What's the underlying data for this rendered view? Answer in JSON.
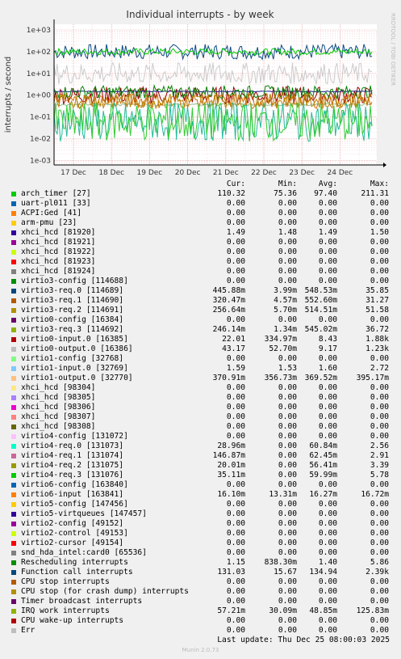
{
  "chart_data": {
    "type": "line",
    "title": "Individual interrupts - by week",
    "ylabel": "interrupts / second",
    "yscale": "log",
    "ylim": [
      0.0005,
      2000
    ],
    "yticks": [
      "1e+03",
      "1e+02",
      "1e+01",
      "1e+00",
      "1e-01",
      "1e-02",
      "1e-03"
    ],
    "xticks": [
      "17 Dec",
      "18 Dec",
      "19 Dec",
      "20 Dec",
      "21 Dec",
      "22 Dec",
      "23 Dec",
      "24 Dec"
    ],
    "grid": true,
    "series": [
      {
        "name": "Function call interrupts",
        "color": "#0c4a83",
        "level": 100,
        "spread": 0.35
      },
      {
        "name": "arch_timer [27]",
        "color": "#00cc00",
        "level": 100,
        "spread": 0.15
      },
      {
        "name": "virtio1-output.0 [32770]",
        "color": "#8fbc8f",
        "level": 0.37,
        "spread": 0.05
      },
      {
        "name": "virtio0-input.0 [16385]",
        "color": "#990000",
        "level": 1.0,
        "spread": 0.4
      },
      {
        "name": "xhci_hcd [81920]",
        "color": "#1c1c8c",
        "level": 1.49,
        "spread": 0.02
      },
      {
        "name": "Rescheduling interrupts",
        "color": "#008000",
        "level": 1.4,
        "spread": 0.3
      },
      {
        "name": "virtio0-output.0 [16386]",
        "color": "#cccccc",
        "level": 10,
        "spread": 0.5
      },
      {
        "name": "virtio3-req.1 [114690]",
        "color": "#cc7000",
        "level": 0.55,
        "spread": 0.35
      },
      {
        "name": "virtio3-req.3 [114692]",
        "color": "#b8860b",
        "level": 0.55,
        "spread": 0.35
      },
      {
        "name": "virtio4-req.0 [131073]",
        "color": "#22bb99",
        "level": 0.06,
        "spread": 0.9
      },
      {
        "name": "virtio4-req.3 [131076]",
        "color": "#33cc33",
        "level": 0.06,
        "spread": 0.9
      }
    ],
    "legend_header": {
      "cur": "Cur:",
      "min": "Min:",
      "avg": "Avg:",
      "max": "Max:"
    },
    "legend": [
      {
        "name": "arch_timer [27]",
        "color": "#00cc00",
        "cur": "110.32",
        "min": "75.36",
        "avg": "97.40",
        "max": "211.31"
      },
      {
        "name": "uart-pl011 [33]",
        "color": "#0066b3",
        "cur": "0.00",
        "min": "0.00",
        "avg": "0.00",
        "max": "0.00"
      },
      {
        "name": "ACPI:Ged [41]",
        "color": "#ff8000",
        "cur": "0.00",
        "min": "0.00",
        "avg": "0.00",
        "max": "0.00"
      },
      {
        "name": "arm-pmu [23]",
        "color": "#ffcc00",
        "cur": "0.00",
        "min": "0.00",
        "avg": "0.00",
        "max": "0.00"
      },
      {
        "name": "xhci_hcd [81920]",
        "color": "#330099",
        "cur": "1.49",
        "min": "1.48",
        "avg": "1.49",
        "max": "1.50"
      },
      {
        "name": "xhci_hcd [81921]",
        "color": "#990099",
        "cur": "0.00",
        "min": "0.00",
        "avg": "0.00",
        "max": "0.00"
      },
      {
        "name": "xhci_hcd [81922]",
        "color": "#ccff00",
        "cur": "0.00",
        "min": "0.00",
        "avg": "0.00",
        "max": "0.00"
      },
      {
        "name": "xhci_hcd [81923]",
        "color": "#ff0000",
        "cur": "0.00",
        "min": "0.00",
        "avg": "0.00",
        "max": "0.00"
      },
      {
        "name": "xhci_hcd [81924]",
        "color": "#808080",
        "cur": "0.00",
        "min": "0.00",
        "avg": "0.00",
        "max": "0.00"
      },
      {
        "name": "virtio3-config [114688]",
        "color": "#008f00",
        "cur": "0.00",
        "min": "0.00",
        "avg": "0.00",
        "max": "0.00"
      },
      {
        "name": "virtio3-req.0 [114689]",
        "color": "#00487d",
        "cur": "445.88m",
        "min": "3.99m",
        "avg": "548.53m",
        "max": "35.85"
      },
      {
        "name": "virtio3-req.1 [114690]",
        "color": "#b35a00",
        "cur": "320.47m",
        "min": "4.57m",
        "avg": "552.60m",
        "max": "31.27"
      },
      {
        "name": "virtio3-req.2 [114691]",
        "color": "#b38f00",
        "cur": "256.64m",
        "min": "5.70m",
        "avg": "514.51m",
        "max": "51.58"
      },
      {
        "name": "virtio0-config [16384]",
        "color": "#6b006b",
        "cur": "0.00",
        "min": "0.00",
        "avg": "0.00",
        "max": "0.00"
      },
      {
        "name": "virtio3-req.3 [114692]",
        "color": "#8fb300",
        "cur": "246.14m",
        "min": "1.34m",
        "avg": "545.02m",
        "max": "36.72"
      },
      {
        "name": "virtio0-input.0 [16385]",
        "color": "#b30000",
        "cur": "22.01",
        "min": "334.97m",
        "avg": "8.43",
        "max": "1.88k"
      },
      {
        "name": "virtio0-output.0 [16386]",
        "color": "#bebebe",
        "cur": "43.17",
        "min": "52.70m",
        "avg": "9.17",
        "max": "1.23k"
      },
      {
        "name": "virtio1-config [32768]",
        "color": "#80ff80",
        "cur": "0.00",
        "min": "0.00",
        "avg": "0.00",
        "max": "0.00"
      },
      {
        "name": "virtio1-input.0 [32769]",
        "color": "#80c9ff",
        "cur": "1.59",
        "min": "1.53",
        "avg": "1.60",
        "max": "2.72"
      },
      {
        "name": "virtio1-output.0 [32770]",
        "color": "#ffc080",
        "cur": "370.91m",
        "min": "356.73m",
        "avg": "369.52m",
        "max": "395.17m"
      },
      {
        "name": "xhci_hcd [98304]",
        "color": "#ffe680",
        "cur": "0.00",
        "min": "0.00",
        "avg": "0.00",
        "max": "0.00"
      },
      {
        "name": "xhci_hcd [98305]",
        "color": "#aa80ff",
        "cur": "0.00",
        "min": "0.00",
        "avg": "0.00",
        "max": "0.00"
      },
      {
        "name": "xhci_hcd [98306]",
        "color": "#ee00cc",
        "cur": "0.00",
        "min": "0.00",
        "avg": "0.00",
        "max": "0.00"
      },
      {
        "name": "xhci_hcd [98307]",
        "color": "#ff8080",
        "cur": "0.00",
        "min": "0.00",
        "avg": "0.00",
        "max": "0.00"
      },
      {
        "name": "xhci_hcd [98308]",
        "color": "#666600",
        "cur": "0.00",
        "min": "0.00",
        "avg": "0.00",
        "max": "0.00"
      },
      {
        "name": "virtio4-config [131072]",
        "color": "#ffbfff",
        "cur": "0.00",
        "min": "0.00",
        "avg": "0.00",
        "max": "0.00"
      },
      {
        "name": "virtio4-req.0 [131073]",
        "color": "#00ffcc",
        "cur": "28.96m",
        "min": "0.00",
        "avg": "60.84m",
        "max": "2.56"
      },
      {
        "name": "virtio4-req.1 [131074]",
        "color": "#cc6699",
        "cur": "146.87m",
        "min": "0.00",
        "avg": "62.45m",
        "max": "2.91"
      },
      {
        "name": "virtio4-req.2 [131075]",
        "color": "#999900",
        "cur": "20.01m",
        "min": "0.00",
        "avg": "56.41m",
        "max": "3.39"
      },
      {
        "name": "virtio4-req.3 [131076]",
        "color": "#00cc00",
        "cur": "35.11m",
        "min": "0.00",
        "avg": "59.99m",
        "max": "5.78"
      },
      {
        "name": "virtio6-config [163840]",
        "color": "#0066b3",
        "cur": "0.00",
        "min": "0.00",
        "avg": "0.00",
        "max": "0.00"
      },
      {
        "name": "virtio6-input [163841]",
        "color": "#ff8000",
        "cur": "16.10m",
        "min": "13.31m",
        "avg": "16.27m",
        "max": "16.72m"
      },
      {
        "name": "virtio5-config [147456]",
        "color": "#ffcc00",
        "cur": "0.00",
        "min": "0.00",
        "avg": "0.00",
        "max": "0.00"
      },
      {
        "name": "virtio5-virtqueues [147457]",
        "color": "#330099",
        "cur": "0.00",
        "min": "0.00",
        "avg": "0.00",
        "max": "0.00"
      },
      {
        "name": "virtio2-config [49152]",
        "color": "#990099",
        "cur": "0.00",
        "min": "0.00",
        "avg": "0.00",
        "max": "0.00"
      },
      {
        "name": "virtio2-control [49153]",
        "color": "#ccff00",
        "cur": "0.00",
        "min": "0.00",
        "avg": "0.00",
        "max": "0.00"
      },
      {
        "name": "virtio2-cursor [49154]",
        "color": "#ff0000",
        "cur": "0.00",
        "min": "0.00",
        "avg": "0.00",
        "max": "0.00"
      },
      {
        "name": "snd_hda_intel:card0 [65536]",
        "color": "#808080",
        "cur": "0.00",
        "min": "0.00",
        "avg": "0.00",
        "max": "0.00"
      },
      {
        "name": "Rescheduling interrupts",
        "color": "#008f00",
        "cur": "1.15",
        "min": "838.30m",
        "avg": "1.40",
        "max": "5.86"
      },
      {
        "name": "Function call interrupts",
        "color": "#00487d",
        "cur": "131.03",
        "min": "15.67",
        "avg": "134.94",
        "max": "2.39k"
      },
      {
        "name": "CPU stop interrupts",
        "color": "#b35a00",
        "cur": "0.00",
        "min": "0.00",
        "avg": "0.00",
        "max": "0.00"
      },
      {
        "name": "CPU stop (for crash dump) interrupts",
        "color": "#b38f00",
        "cur": "0.00",
        "min": "0.00",
        "avg": "0.00",
        "max": "0.00"
      },
      {
        "name": "Timer broadcast interrupts",
        "color": "#6b006b",
        "cur": "0.00",
        "min": "0.00",
        "avg": "0.00",
        "max": "0.00"
      },
      {
        "name": "IRQ work interrupts",
        "color": "#8fb300",
        "cur": "57.21m",
        "min": "30.09m",
        "avg": "48.85m",
        "max": "125.83m"
      },
      {
        "name": "CPU wake-up interrupts",
        "color": "#b30000",
        "cur": "0.00",
        "min": "0.00",
        "avg": "0.00",
        "max": "0.00"
      },
      {
        "name": "Err",
        "color": "#bebebe",
        "cur": "0.00",
        "min": "0.00",
        "avg": "0.00",
        "max": "0.00"
      }
    ]
  },
  "side_label": "RRDTOOL / TOBI OETIKER",
  "last_update": "Last update: Thu Dec 25 08:00:03 2025",
  "footer": "Munin 2.0.73"
}
